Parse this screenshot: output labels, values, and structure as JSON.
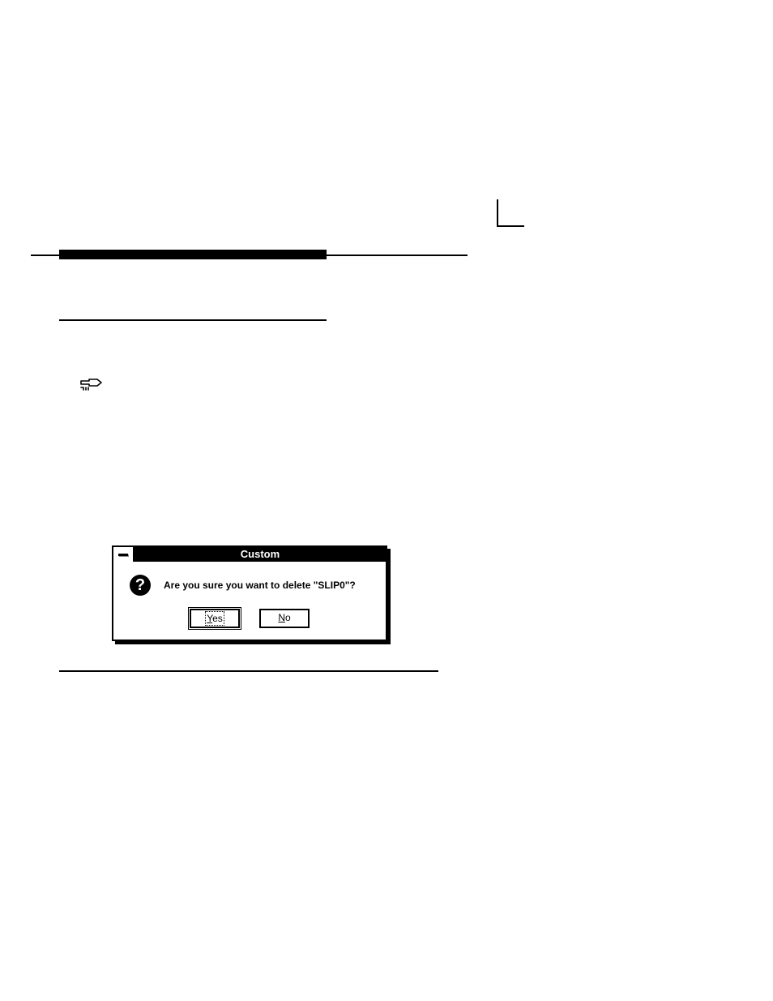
{
  "dialog": {
    "title": "Custom",
    "message": "Are you sure you want to delete \"SLIP0\"?",
    "buttons": {
      "yes_prefix": "Y",
      "yes_rest": "es",
      "no_prefix": "N",
      "no_rest": "o"
    }
  }
}
